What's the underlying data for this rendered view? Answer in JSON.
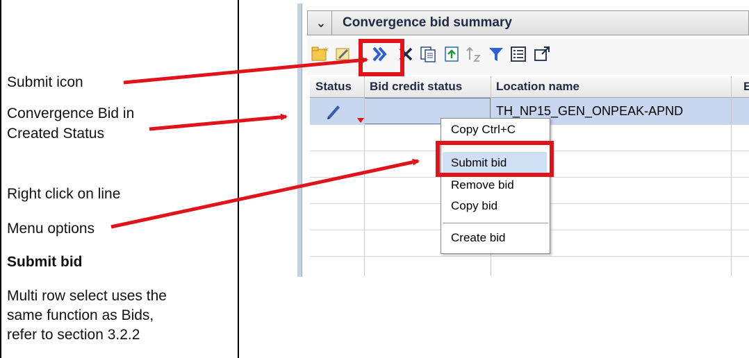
{
  "left_panel": {
    "submit_icon_label": "Submit icon",
    "created_status_line1": "Convergence Bid in",
    "created_status_line2": "Created Status",
    "right_click_label": "Right click on line",
    "menu_options_label": "Menu options",
    "section_heading": "Submit bid",
    "note_line1": "Multi row select uses the",
    "note_line2": "same function as Bids,",
    "note_line3": "refer to section 3.2.2"
  },
  "summary": {
    "title": "Convergence bid summary",
    "toolbar_icons": [
      "new-bid-icon",
      "edit-icon",
      "submit-icon",
      "delete-icon",
      "copy-icon",
      "upload-icon",
      "sort-icon",
      "filter-icon",
      "columns-icon",
      "popout-icon"
    ]
  },
  "grid": {
    "columns": [
      "Status",
      "Bid credit status",
      "Location name",
      "E"
    ],
    "rows": [
      {
        "status_icon": "pencil-icon",
        "bid_credit_status": "",
        "location_name": "TH_NP15_GEN_ONPEAK-APND"
      }
    ]
  },
  "context_menu": {
    "items": [
      "Copy Ctrl+C",
      "Submit bid",
      "Remove bid",
      "Copy bid",
      "Create bid"
    ],
    "highlighted": "Submit bid"
  },
  "colors": {
    "annotation_red": "#e0121a",
    "selection_blue": "#c7d7ef",
    "submit_icon_blue": "#2f5fd6"
  }
}
